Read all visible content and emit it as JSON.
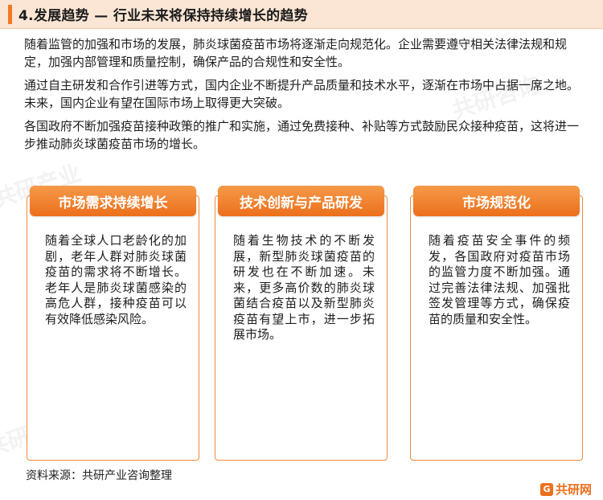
{
  "header": {
    "title": "4.发展趋势 — 行业未来将保持持续增长的趋势"
  },
  "intro": {
    "paragraphs": [
      "随着监管的加强和市场的发展，肺炎球菌疫苗市场将逐渐走向规范化。企业需要遵守相关法律法规和规定，加强内部管理和质量控制，确保产品的合规性和安全性。",
      "通过自主研发和合作引进等方式，国内企业不断提升产品质量和技术水平，逐渐在市场中占据一席之地。未来，国内企业有望在国际市场上取得更大突破。",
      "各国政府不断加强疫苗接种政策的推广和实施，通过免费接种、补贴等方式鼓励民众接种疫苗，这将进一步推动肺炎球菌疫苗市场的增长。"
    ]
  },
  "cards": [
    {
      "title": "市场需求持续增长",
      "body": "随着全球人口老龄化的加剧，老年人群对肺炎球菌疫苗的需求将不断增长。老年人是肺炎球菌感染的高危人群，接种疫苗可以有效降低感染风险。"
    },
    {
      "title": "技术创新与产品研发",
      "body": "随着生物技术的不断发展，新型肺炎球菌疫苗的研发也在不断加速。未来，更多高价数的肺炎球菌结合疫苗以及新型肺炎疫苗有望上市，进一步拓展市场。"
    },
    {
      "title": "市场规范化",
      "body": "随着疫苗安全事件的频发，各国政府对疫苗市场的监管力度不断加强。通过完善法律法规、加强批签发管理等方式，确保疫苗的质量和安全性。"
    }
  ],
  "footer": {
    "source": "资料来源：共研产业咨询整理"
  },
  "logo": {
    "text": "共研网",
    "mark": "G",
    "color": "#ec6f1b"
  },
  "colors": {
    "accent": "#f07a22",
    "header_bg": "#fbe6d5"
  }
}
